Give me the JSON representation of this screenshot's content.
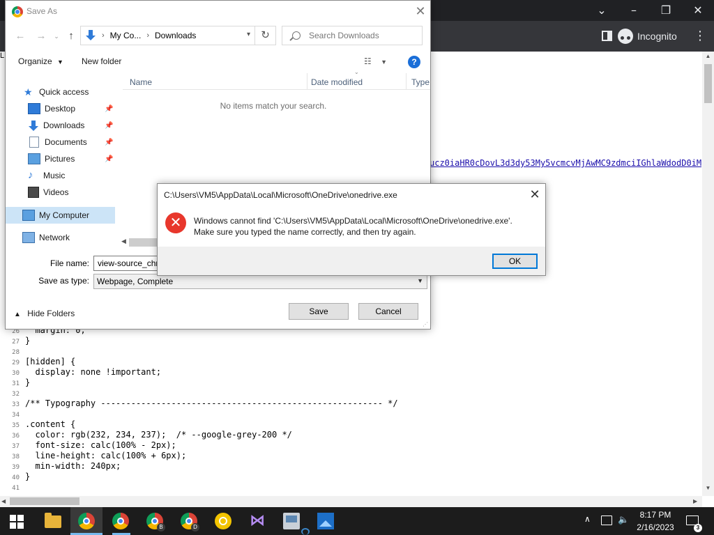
{
  "browser": {
    "incognito_label": "Incognito",
    "link_text": "ucz0iaHR0cDovL3d3dy53My5vcmcvMjAwMC9zdmciIGhlaWdodD0iMj",
    "left_sliver": "L"
  },
  "source_lines": [
    {
      "n": "26",
      "text": "  margin: 0;"
    },
    {
      "n": "27",
      "text": "}"
    },
    {
      "n": "28",
      "text": ""
    },
    {
      "n": "29",
      "text": "[hidden] {"
    },
    {
      "n": "30",
      "text": "  display: none !important;"
    },
    {
      "n": "31",
      "text": "}"
    },
    {
      "n": "32",
      "text": ""
    },
    {
      "n": "33",
      "text": "/** Typography -------------------------------------------------------- */"
    },
    {
      "n": "34",
      "text": ""
    },
    {
      "n": "35",
      "text": ".content {"
    },
    {
      "n": "36",
      "text": "  color: rgb(232, 234, 237);  /* --google-grey-200 */"
    },
    {
      "n": "37",
      "text": "  font-size: calc(100% - 2px);"
    },
    {
      "n": "38",
      "text": "  line-height: calc(100% + 6px);"
    },
    {
      "n": "39",
      "text": "  min-width: 240px;"
    },
    {
      "n": "40",
      "text": "}"
    },
    {
      "n": "41",
      "text": ""
    }
  ],
  "save_dialog": {
    "title": "Save As",
    "breadcrumb": [
      "My Co...",
      "Downloads"
    ],
    "search_placeholder": "Search Downloads",
    "organize_label": "Organize",
    "new_folder_label": "New folder",
    "nav_items": [
      {
        "label": "Quick access",
        "icon": "star-icon"
      },
      {
        "label": "Desktop",
        "icon": "desktop-icon",
        "pinned": true
      },
      {
        "label": "Downloads",
        "icon": "download-icon",
        "pinned": true
      },
      {
        "label": "Documents",
        "icon": "documents-icon",
        "pinned": true
      },
      {
        "label": "Pictures",
        "icon": "pictures-icon",
        "pinned": true
      },
      {
        "label": "Music",
        "icon": "music-icon"
      },
      {
        "label": "Videos",
        "icon": "videos-icon"
      },
      {
        "label": "My Computer",
        "icon": "computer-icon",
        "selected": true
      },
      {
        "label": "Network",
        "icon": "network-icon"
      }
    ],
    "columns": [
      "Name",
      "Date modified",
      "Type"
    ],
    "empty_message": "No items match your search.",
    "file_name_label": "File name:",
    "file_name_value": "view-source_chr",
    "save_as_type_label": "Save as type:",
    "save_as_type_value": "Webpage, Complete",
    "hide_folders_label": "Hide Folders",
    "save_button": "Save",
    "cancel_button": "Cancel"
  },
  "error_dialog": {
    "title": "C:\\Users\\VM5\\AppData\\Local\\Microsoft\\OneDrive\\onedrive.exe",
    "message_line1": "Windows cannot find 'C:\\Users\\VM5\\AppData\\Local\\Microsoft\\OneDrive\\onedrive.exe'.",
    "message_line2": "Make sure you typed the name correctly, and then try again.",
    "ok_button": "OK"
  },
  "taskbar": {
    "chrome_badges": [
      "B",
      "D"
    ],
    "time": "8:17 PM",
    "date": "2/16/2023",
    "notification_count": "3"
  },
  "colors": {
    "chrome_dark": "#202124",
    "toolbar": "#35363a",
    "error_red": "#e8372c",
    "link": "#1a0dab",
    "accent": "#0078d7"
  }
}
